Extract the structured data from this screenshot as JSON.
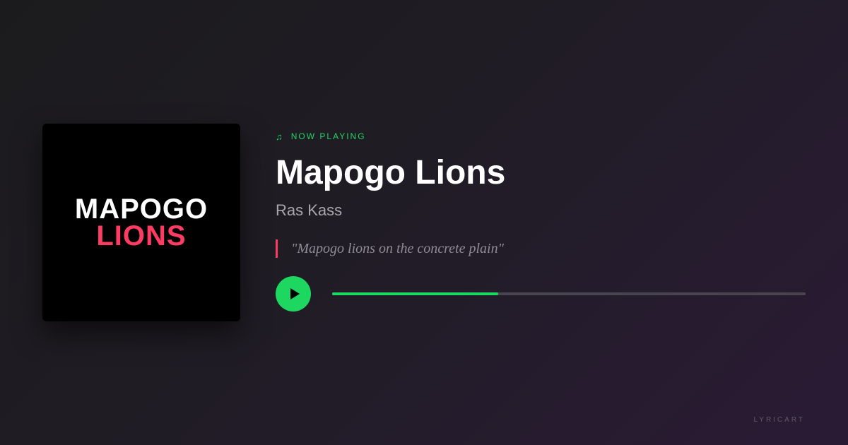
{
  "cover": {
    "line1": "MAPOGO",
    "line2": "LIONS"
  },
  "header": {
    "now_playing_label": "NOW PLAYING",
    "icon": "music-note-icon"
  },
  "track": {
    "title": "Mapogo Lions",
    "artist": "Ras Kass",
    "lyric": "\"Mapogo lions on the concrete plain\""
  },
  "player": {
    "play_icon": "play-icon",
    "progress_fraction": 0.35
  },
  "footer": {
    "brand": "LYRICART"
  },
  "colors": {
    "accent_green": "#1ed760",
    "accent_pink": "#ff3b63",
    "background_start": "#1b1b1d",
    "background_end": "#2a1b35"
  }
}
